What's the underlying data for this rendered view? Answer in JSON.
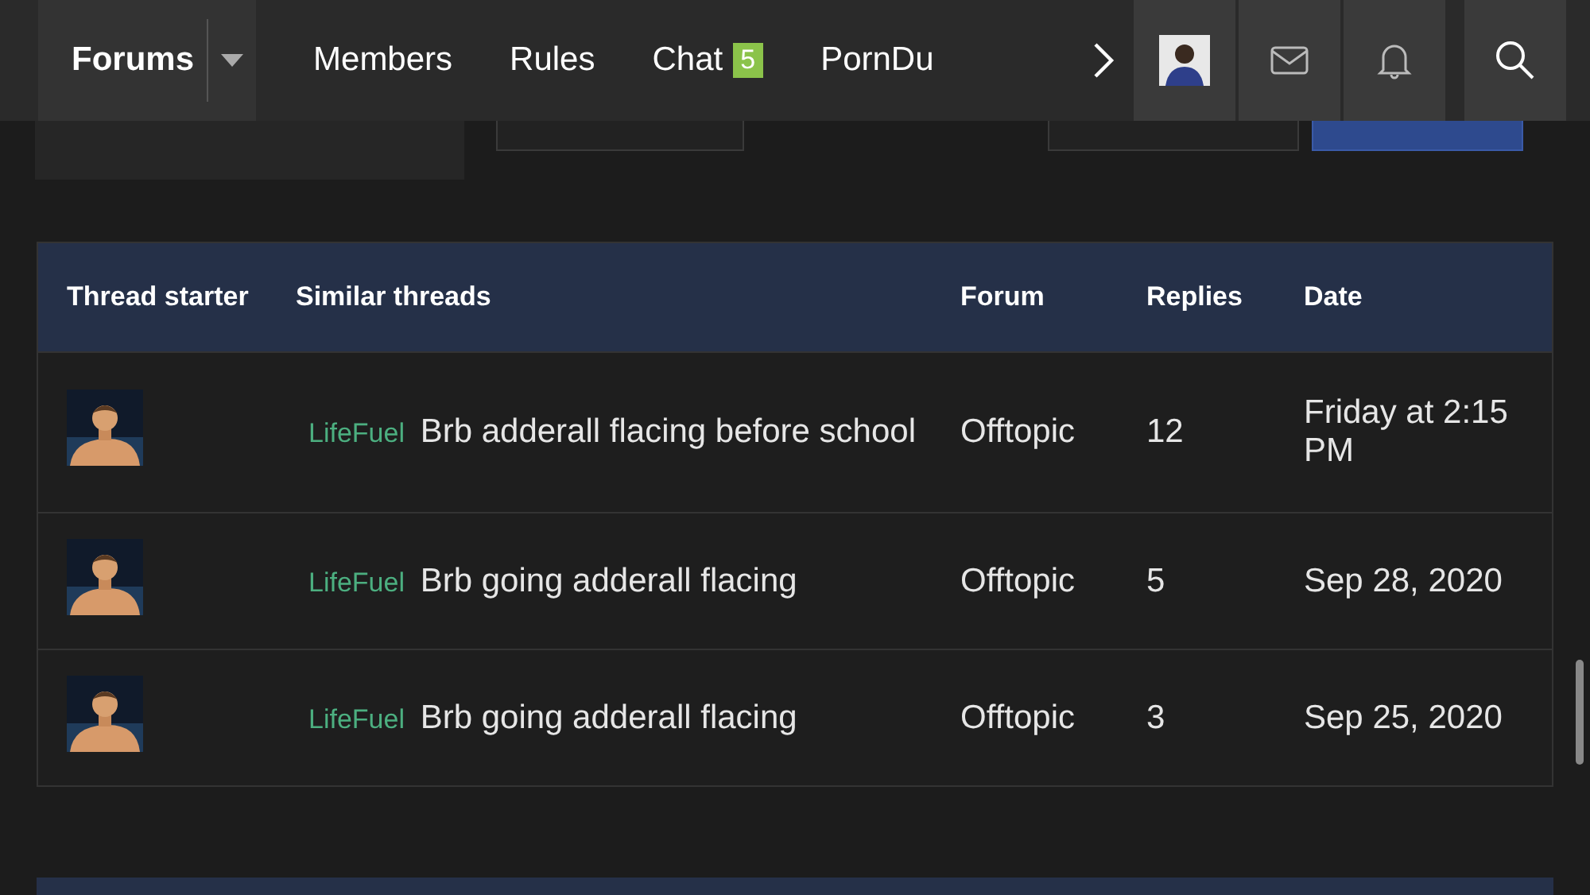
{
  "nav": {
    "items": [
      {
        "label": "Forums",
        "selected": true,
        "kind": "dropdown"
      },
      {
        "label": "Members",
        "selected": false,
        "kind": "link"
      },
      {
        "label": "Rules",
        "selected": false,
        "kind": "link"
      },
      {
        "label": "Chat",
        "selected": false,
        "kind": "link",
        "badge": "5"
      },
      {
        "label": "PornDu",
        "selected": false,
        "kind": "link"
      }
    ]
  },
  "table": {
    "columns": [
      "Thread starter",
      "Similar threads",
      "Forum",
      "Replies",
      "Date"
    ],
    "rows": [
      {
        "prefix": "LifeFuel",
        "title": "Brb adderall flacing before school",
        "forum": "Offtopic",
        "replies": "12",
        "date": "Friday at 2:15 PM"
      },
      {
        "prefix": "LifeFuel",
        "title": "Brb going adderall flacing",
        "forum": "Offtopic",
        "replies": "5",
        "date": "Sep 28, 2020"
      },
      {
        "prefix": "LifeFuel",
        "title": "Brb going adderall flacing",
        "forum": "Offtopic",
        "replies": "3",
        "date": "Sep 25, 2020"
      }
    ]
  }
}
